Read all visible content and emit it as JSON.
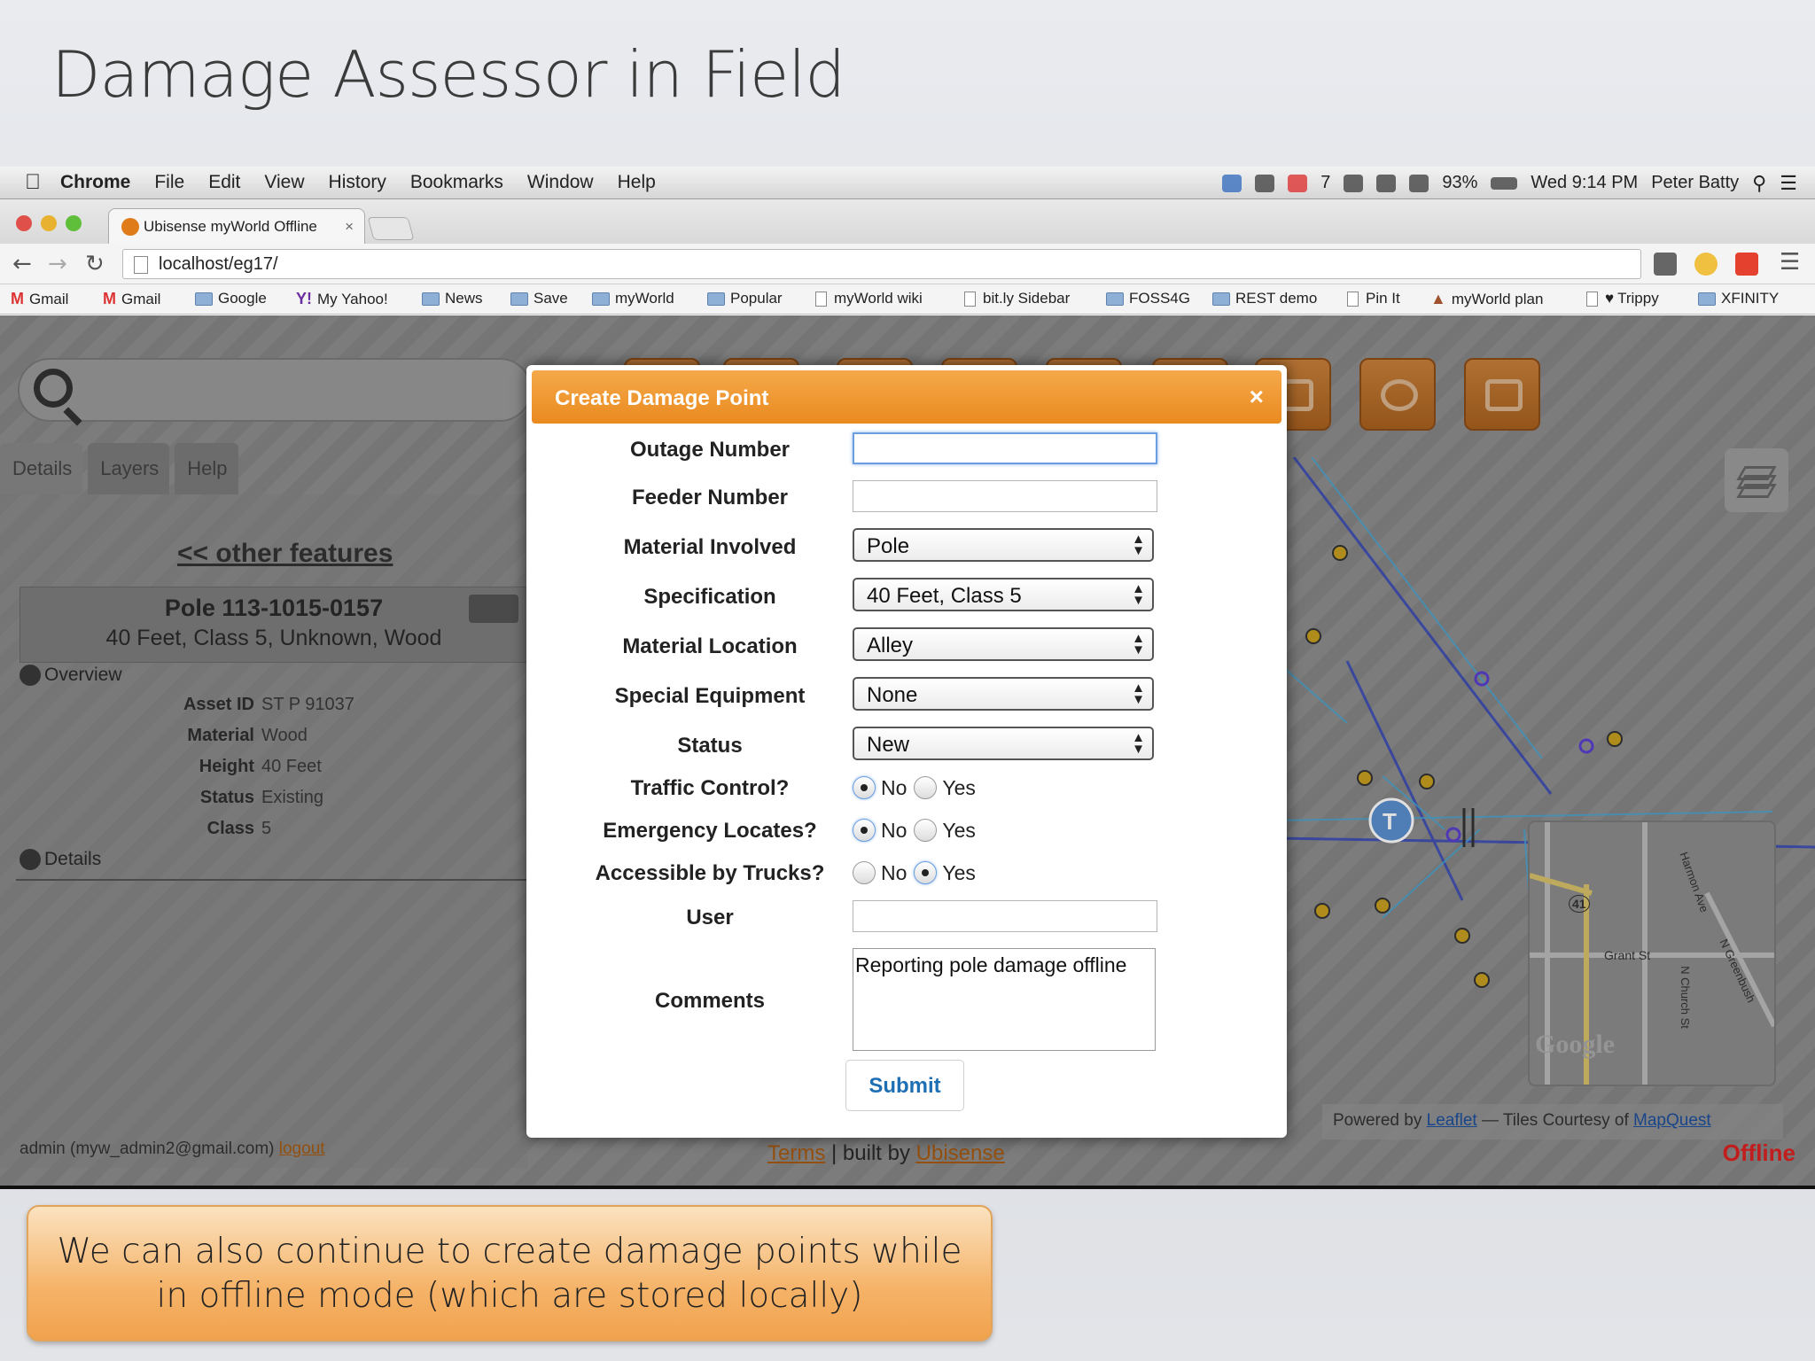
{
  "slide_title": "Damage Assessor in Field",
  "caption": "We can also continue to create damage points while in offline mode (which are stored locally)",
  "mac_menubar": {
    "app": "Chrome",
    "menus": [
      "File",
      "Edit",
      "View",
      "History",
      "Bookmarks",
      "Window",
      "Help"
    ],
    "mail_count": "7",
    "battery": "93%",
    "clock": "Wed 9:14 PM",
    "user": "Peter Batty"
  },
  "browser": {
    "tab_title": "Ubisense myWorld Offline",
    "url": "localhost/eg17/",
    "bookmarks": [
      "Gmail",
      "Gmail",
      "Google",
      "My Yahoo!",
      "News",
      "Save",
      "myWorld",
      "Popular",
      "myWorld wiki",
      "bit.ly Sidebar",
      "FOSS4G",
      "REST demo",
      "Pin It",
      "myWorld plan",
      "Trippy",
      "XFINITY"
    ]
  },
  "panel": {
    "tabs": [
      "Details",
      "Layers",
      "Help"
    ],
    "other_features_link": "<< other features",
    "feature_title": "Pole 113-1015-0157",
    "feature_subtitle": "40 Feet, Class 5, Unknown, Wood",
    "overview_label": "Overview",
    "details_label": "Details",
    "attributes": [
      {
        "k": "Asset ID",
        "v": "ST P 91037"
      },
      {
        "k": "Material",
        "v": "Wood"
      },
      {
        "k": "Height",
        "v": "40 Feet"
      },
      {
        "k": "Status",
        "v": "Existing"
      },
      {
        "k": "Class",
        "v": "5"
      }
    ]
  },
  "footer": {
    "user": "admin (myw_admin2@gmail.com)",
    "logout": "logout",
    "terms": "Terms",
    "built_by": "| built by",
    "ubisense": "Ubisense",
    "powered_by": "Powered by",
    "leaflet": "Leaflet",
    "tiles": "— Tiles Courtesy of",
    "mapquest": "MapQuest",
    "status": "Offline"
  },
  "minimap_labels": [
    "Grant St",
    "N Church St",
    "Harmon Ave",
    "N Greenbush",
    "41",
    "Google"
  ],
  "dialog": {
    "title": "Create Damage Point",
    "close": "×",
    "fields": {
      "outage_number": {
        "label": "Outage Number",
        "value": ""
      },
      "feeder_number": {
        "label": "Feeder Number",
        "value": ""
      },
      "material_involved": {
        "label": "Material Involved",
        "value": "Pole"
      },
      "specification": {
        "label": "Specification",
        "value": "40 Feet, Class 5"
      },
      "material_location": {
        "label": "Material Location",
        "value": "Alley"
      },
      "special_equipment": {
        "label": "Special Equipment",
        "value": "None"
      },
      "status": {
        "label": "Status",
        "value": "New"
      },
      "traffic_control": {
        "label": "Traffic Control?",
        "selected": "No"
      },
      "emergency_locates": {
        "label": "Emergency Locates?",
        "selected": "No"
      },
      "accessible_by_trucks": {
        "label": "Accessible by Trucks?",
        "selected": "Yes"
      },
      "user": {
        "label": "User",
        "value": ""
      },
      "comments": {
        "label": "Comments",
        "value": "Reporting pole damage offline"
      }
    },
    "radio_no": "No",
    "radio_yes": "Yes",
    "submit": "Submit"
  },
  "colors": {
    "dialog_header": "#ea8a1f",
    "offline_red": "#dd2222",
    "link_orange": "#a85a10",
    "map_line_blue": "#2a3fc0"
  }
}
